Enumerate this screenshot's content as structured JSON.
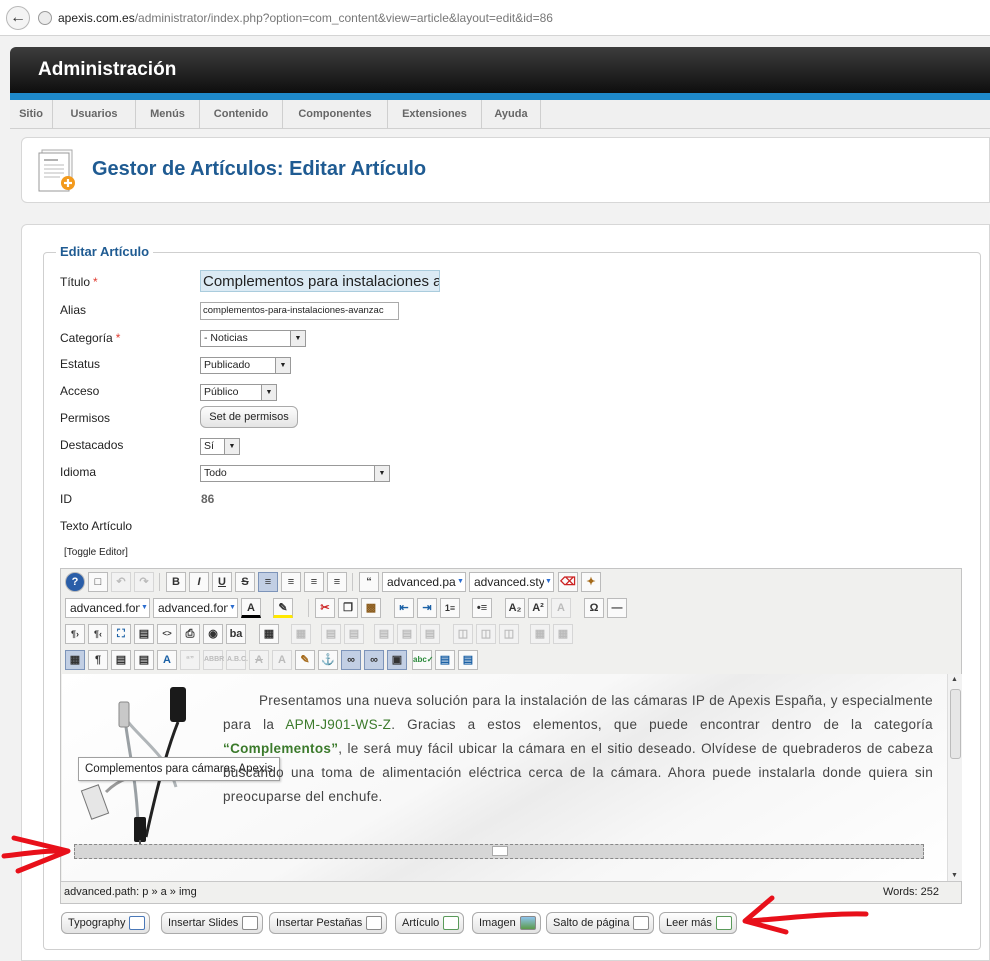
{
  "browser": {
    "back_icon": "back-arrow-icon",
    "page_icon": "globe-icon",
    "url_domain": "apexis.com.es",
    "url_path": "/administrator/index.php?option=com_content&view=article&layout=edit&id=86"
  },
  "header": {
    "title": "Administración"
  },
  "menu": {
    "items": [
      "Sitio",
      "Usuarios",
      "Menús",
      "Contenido",
      "Componentes",
      "Extensiones",
      "Ayuda"
    ]
  },
  "page": {
    "title": "Gestor de Artículos: Editar Artículo",
    "icon": "article-add-icon"
  },
  "form": {
    "legend": "Editar Artículo",
    "labels": {
      "title": "Título",
      "alias": "Alias",
      "category": "Categoría",
      "status": "Estatus",
      "access": "Acceso",
      "permissions": "Permisos",
      "featured": "Destacados",
      "language": "Idioma",
      "id": "ID",
      "text": "Texto Artículo"
    },
    "required_mark": "*",
    "values": {
      "title": "Complementos para instalaciones a",
      "alias": "complementos-para-instalaciones-avanzac",
      "category": "- Noticias",
      "status": "Publicado",
      "access": "Público",
      "featured": "Sí",
      "language": "Todo",
      "id": "86"
    },
    "permissions_button": "Set de permisos",
    "toggle_editor": "[Toggle Editor]"
  },
  "editor": {
    "dropdowns": {
      "paragraph": "advanced.para",
      "style": "advanced.style",
      "font": "advanced.font",
      "font_size": "advanced.font"
    },
    "toolbar_glyphs": {
      "bold": "B",
      "italic": "I",
      "underline": "U",
      "strike": "S",
      "blockquote": "“",
      "subscript": "A₂",
      "superscript": "A²",
      "omega": "Ω",
      "pilcrow": "¶",
      "rtl": "¶‹",
      "ltr": "¶›",
      "replace": "ba"
    },
    "content": {
      "intro": "Presentamos una nueva solución para la instalación de las cámaras IP de Apexis España, y especialmente para la ",
      "link1": "APM-J901-WS-Z",
      "mid": ". Gracias a estos elementos, que puede encontrar dentro de la categoría ",
      "quote_open": "“",
      "link2": "Complementos",
      "quote_close": "”",
      "rest": ", le será muy fácil ubicar la cámara en el sitio deseado. Olvídese de quebraderos de cabeza buscando una toma de alimentación eléctrica cerca de la cámara. Ahora puede instalarla donde quiera sin preocuparse del enchufe.",
      "tooltip": "Complementos para cámaras Apexis"
    },
    "status_path": "advanced.path:  p » a » img",
    "word_count": "Words: 252"
  },
  "buttons": [
    {
      "label": "Typography",
      "icon": "typography-icon"
    },
    {
      "label": "Insertar Slides",
      "icon": "slides-icon"
    },
    {
      "label": "Insertar Pestañas",
      "icon": "tabs-icon"
    },
    {
      "label": "Artículo",
      "icon": "article-icon"
    },
    {
      "label": "Imagen",
      "icon": "image-icon"
    },
    {
      "label": "Salto de página",
      "icon": "pagebreak-icon"
    },
    {
      "label": "Leer más",
      "icon": "readmore-icon"
    }
  ],
  "colors": {
    "accent_bar": "#1e88c9",
    "title_blue": "#1f5b92",
    "link_green": "#3b7a2b",
    "arrow_red": "#e8101a"
  }
}
